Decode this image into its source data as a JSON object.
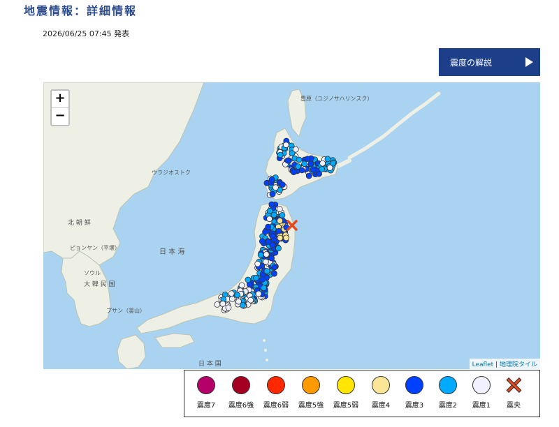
{
  "header": {
    "title": "地震情報：詳細情報",
    "issued": "2026/06/25 07:45 発表"
  },
  "explain_button": {
    "label": "震度の解説"
  },
  "map": {
    "zoom_in": "+",
    "zoom_out": "−",
    "attribution_leaflet": "Leaflet",
    "attribution_sep": " | ",
    "attribution_tiles": "地理院タイル",
    "place_labels": {
      "yuzhno": "豊原（ユジノサハリンスク）",
      "vladivostok": "ウラジオストク",
      "nk": "北 朝 鮮",
      "pyongyang": "ピョンヤン（平壌）",
      "seoul": "ソウル",
      "korea": "大 韓 民 国",
      "busan": "プサン（釜山）",
      "sea_of_japan": "日 本 海",
      "japan": "日 本 国"
    },
    "epicenter": {
      "latitude_note": "",
      "color": "#e8491c"
    },
    "intensity_colors": {
      "1": "#f2f2ff",
      "2": "#00aaff",
      "3": "#0041ff",
      "4": "#fae696",
      "5弱": "#ffe600",
      "5強": "#ff9900",
      "6弱": "#ff2800",
      "6強": "#a50021",
      "7": "#b40068"
    }
  },
  "legend": [
    {
      "label": "震度7",
      "color": "#b40068"
    },
    {
      "label": "震度6強",
      "color": "#a50021"
    },
    {
      "label": "震度6弱",
      "color": "#ff2800"
    },
    {
      "label": "震度5強",
      "color": "#ff9900"
    },
    {
      "label": "震度5弱",
      "color": "#ffe600"
    },
    {
      "label": "震度4",
      "color": "#fae696"
    },
    {
      "label": "震度3",
      "color": "#0041ff"
    },
    {
      "label": "震度2",
      "color": "#00aaff"
    },
    {
      "label": "震度1",
      "color": "#f2f2ff"
    },
    {
      "label": "震央",
      "icon": "epicenter-x-icon"
    }
  ]
}
